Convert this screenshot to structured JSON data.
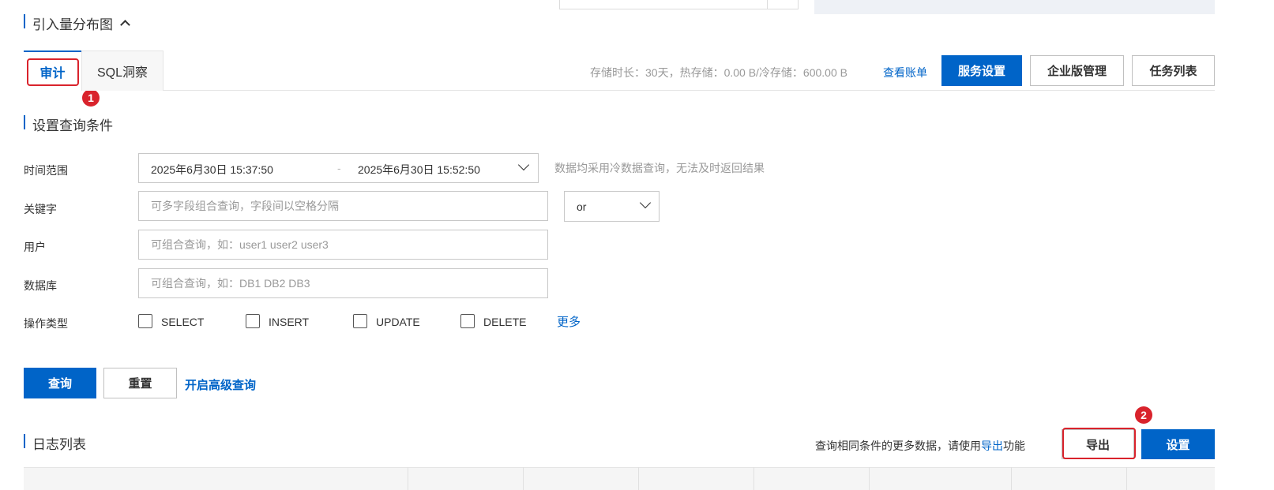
{
  "distribution": {
    "title": "引入量分布图"
  },
  "tabs": [
    {
      "label": "审计",
      "badge": "1"
    },
    {
      "label": "SQL洞察"
    }
  ],
  "storage": {
    "info": "存储时长：30天，热存储：0.00 B/冷存储：600.00 B",
    "view_bill": "查看账单"
  },
  "toolbar": {
    "service_settings": "服务设置",
    "enterprise": "企业版管理",
    "task_list": "任务列表"
  },
  "query_conditions": {
    "title": "设置查询条件",
    "time_range": {
      "label": "时间范围",
      "start": "2025年6月30日 15:37:50",
      "separator": "-",
      "end": "2025年6月30日 15:52:50",
      "hint": "数据均采用冷数据查询，无法及时返回结果"
    },
    "keyword": {
      "label": "关键字",
      "placeholder": "可多字段组合查询，字段间以空格分隔",
      "operator": "or"
    },
    "user": {
      "label": "用户",
      "placeholder": "可组合查询，如：user1 user2 user3"
    },
    "database": {
      "label": "数据库",
      "placeholder": "可组合查询，如：DB1 DB2 DB3"
    },
    "operation_type": {
      "label": "操作类型",
      "options": [
        "SELECT",
        "INSERT",
        "UPDATE",
        "DELETE"
      ],
      "more": "更多"
    }
  },
  "actions": {
    "query": "查询",
    "reset": "重置",
    "advanced": "开启高级查询"
  },
  "log_list": {
    "title": "日志列表",
    "hint_prefix": "查询相同条件的更多数据，请使用",
    "hint_link": "导出",
    "hint_suffix": "功能",
    "export": "导出",
    "export_badge": "2",
    "settings": "设置"
  },
  "colors": {
    "primary": "#0064c8",
    "highlight": "#d9232c"
  }
}
